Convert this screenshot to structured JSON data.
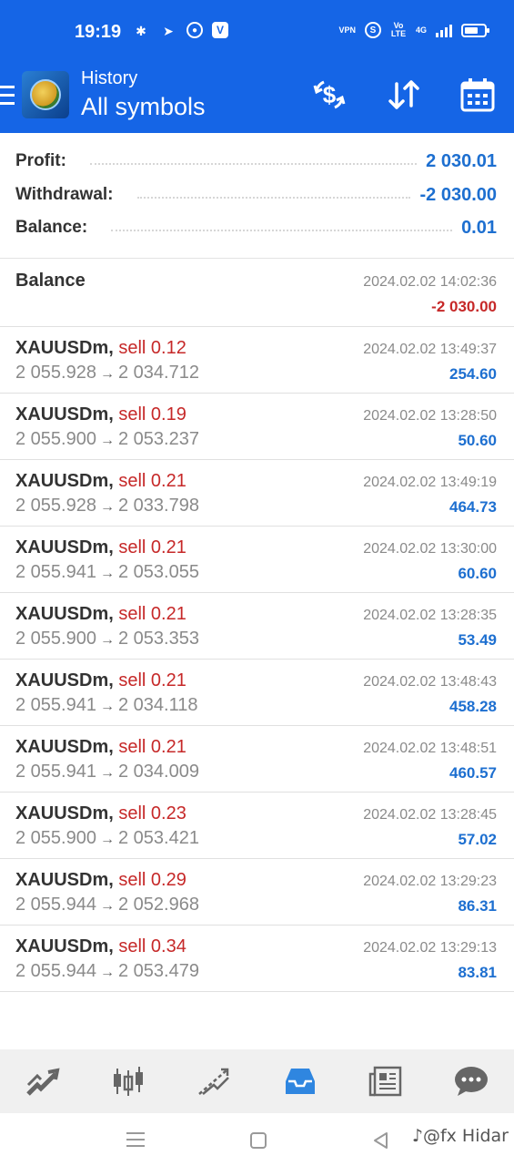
{
  "status_bar": {
    "time": "19:19",
    "network": "4G",
    "vpn_label": "VPN",
    "volte_label": "Vo LTE"
  },
  "header": {
    "subtitle": "History",
    "title": "All symbols",
    "actions": [
      "dollar-exchange-icon",
      "sort-icon",
      "calendar-icon"
    ]
  },
  "summary": {
    "profit_label": "Profit:",
    "profit_value": "2 030.01",
    "withdrawal_label": "Withdrawal:",
    "withdrawal_value": "-2 030.00",
    "balance_label": "Balance:",
    "balance_value": "0.01"
  },
  "balance_entry": {
    "title": "Balance",
    "time": "2024.02.02 14:02:36",
    "amount": "-2 030.00"
  },
  "deals": [
    {
      "symbol": "XAUUSDm,",
      "side": "sell 0.12",
      "open": "2 055.928",
      "close": "2 034.712",
      "time": "2024.02.02 13:49:37",
      "profit": "254.60"
    },
    {
      "symbol": "XAUUSDm,",
      "side": "sell 0.19",
      "open": "2 055.900",
      "close": "2 053.237",
      "time": "2024.02.02 13:28:50",
      "profit": "50.60"
    },
    {
      "symbol": "XAUUSDm,",
      "side": "sell 0.21",
      "open": "2 055.928",
      "close": "2 033.798",
      "time": "2024.02.02 13:49:19",
      "profit": "464.73"
    },
    {
      "symbol": "XAUUSDm,",
      "side": "sell 0.21",
      "open": "2 055.941",
      "close": "2 053.055",
      "time": "2024.02.02 13:30:00",
      "profit": "60.60"
    },
    {
      "symbol": "XAUUSDm,",
      "side": "sell 0.21",
      "open": "2 055.900",
      "close": "2 053.353",
      "time": "2024.02.02 13:28:35",
      "profit": "53.49"
    },
    {
      "symbol": "XAUUSDm,",
      "side": "sell 0.21",
      "open": "2 055.941",
      "close": "2 034.118",
      "time": "2024.02.02 13:48:43",
      "profit": "458.28"
    },
    {
      "symbol": "XAUUSDm,",
      "side": "sell 0.21",
      "open": "2 055.941",
      "close": "2 034.009",
      "time": "2024.02.02 13:48:51",
      "profit": "460.57"
    },
    {
      "symbol": "XAUUSDm,",
      "side": "sell 0.23",
      "open": "2 055.900",
      "close": "2 053.421",
      "time": "2024.02.02 13:28:45",
      "profit": "57.02"
    },
    {
      "symbol": "XAUUSDm,",
      "side": "sell 0.29",
      "open": "2 055.944",
      "close": "2 052.968",
      "time": "2024.02.02 13:29:23",
      "profit": "86.31"
    },
    {
      "symbol": "XAUUSDm,",
      "side": "sell 0.34",
      "open": "2 055.944",
      "close": "2 053.479",
      "time": "2024.02.02 13:29:13",
      "profit": "83.81"
    }
  ],
  "arrow": "→",
  "bottom_nav": [
    "quotes-icon",
    "chart-icon",
    "trade-icon",
    "history-icon",
    "news-icon",
    "chat-icon"
  ],
  "bottom_nav_active": 3,
  "colors": {
    "accent": "#1565e6",
    "profit": "#1d6fd0",
    "loss": "#c62828"
  },
  "watermark": "♪@fx Hidar"
}
